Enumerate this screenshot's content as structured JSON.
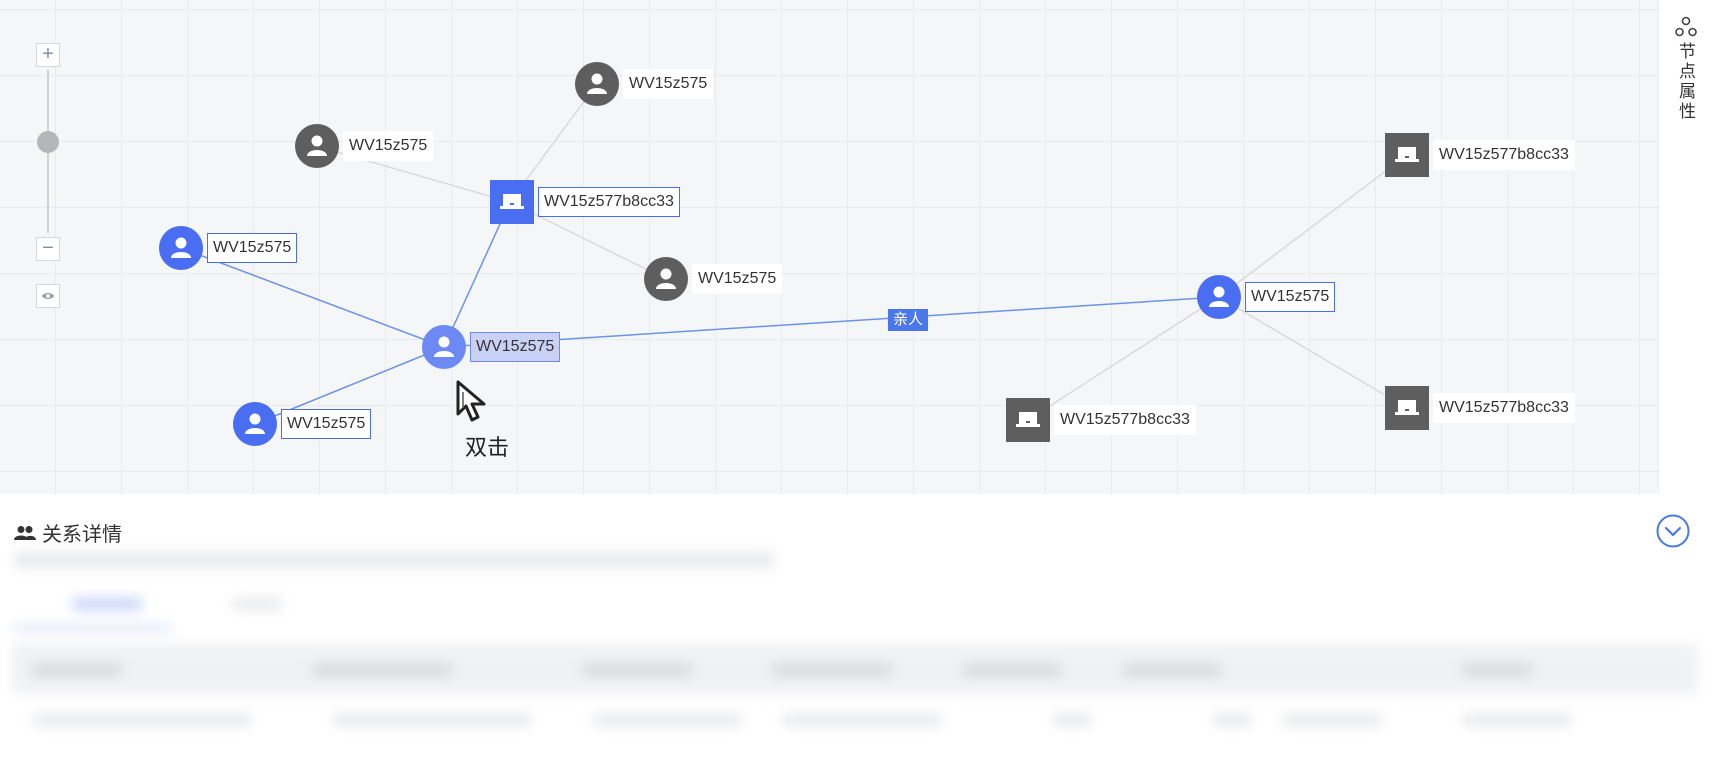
{
  "graph": {
    "nodes": [
      {
        "id": "n1",
        "label": "WV15z575",
        "kind": "person",
        "style": "gray"
      },
      {
        "id": "n2",
        "label": "WV15z575",
        "kind": "person",
        "style": "gray"
      },
      {
        "id": "n3",
        "label": "WV15z577b8cc33",
        "kind": "device",
        "style": "blue"
      },
      {
        "id": "n4",
        "label": "WV15z575",
        "kind": "person",
        "style": "blue"
      },
      {
        "id": "n5",
        "label": "WV15z575",
        "kind": "person",
        "style": "gray"
      },
      {
        "id": "n6",
        "label": "WV15z575",
        "kind": "person",
        "style": "selected"
      },
      {
        "id": "n7",
        "label": "WV15z575",
        "kind": "person",
        "style": "blue"
      },
      {
        "id": "n8",
        "label": "WV15z577b8cc33",
        "kind": "device",
        "style": "gray"
      },
      {
        "id": "n9",
        "label": "WV15z575",
        "kind": "person",
        "style": "blue"
      },
      {
        "id": "n10",
        "label": "WV15z577b8cc33",
        "kind": "device",
        "style": "gray"
      },
      {
        "id": "n11",
        "label": "WV15z577b8cc33",
        "kind": "device",
        "style": "gray"
      }
    ],
    "edge_label": "亲人",
    "edge_color_highlight": "#6b93e8",
    "edge_color_default": "#d9dadc"
  },
  "zoom": {
    "plus": "+",
    "minus": "−",
    "level": 0.55
  },
  "hint": {
    "action_text": "双击"
  },
  "side_panel": {
    "label": "节点属性",
    "icon": "node-tree-icon"
  },
  "bottom_panel": {
    "title": "关系详情",
    "icon": "people-icon",
    "collapse_icon": "chevron-down-circle-icon"
  },
  "colors": {
    "accent": "#4a6ef2",
    "node_gray": "#5e5e5e",
    "selected_fill": "#c9d2f5"
  }
}
